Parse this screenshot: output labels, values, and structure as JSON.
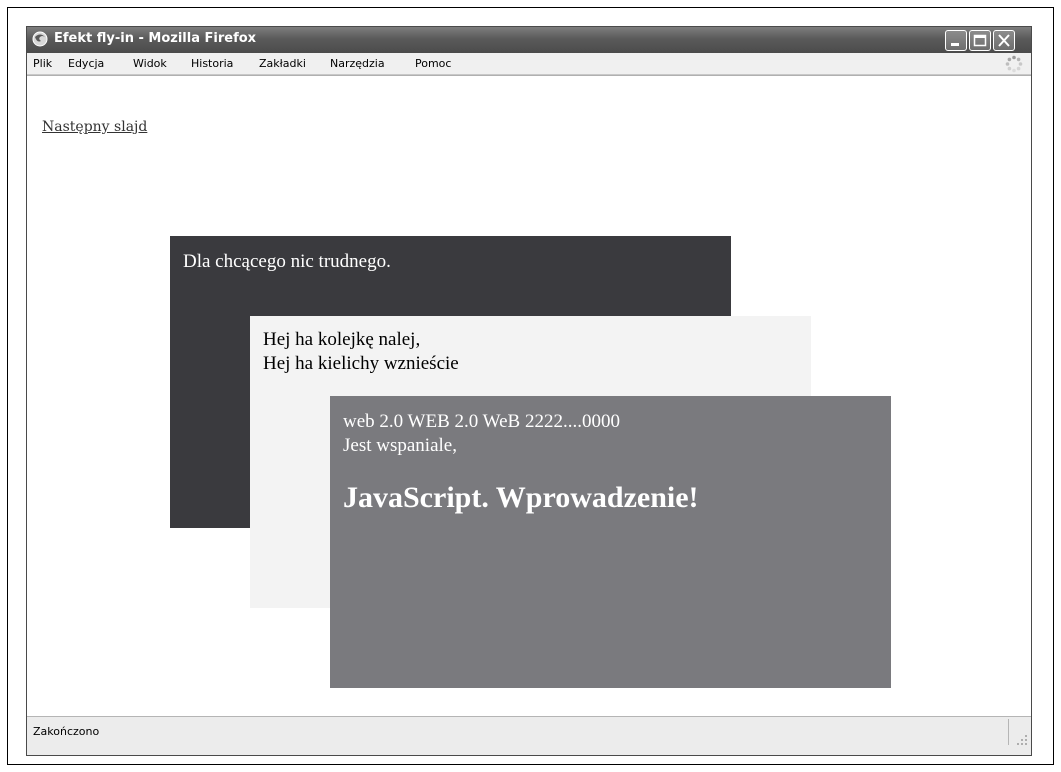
{
  "window": {
    "title": "Efekt fly-in - Mozilla Firefox"
  },
  "menu": {
    "items": [
      {
        "label": "Plik"
      },
      {
        "label": "Edycja"
      },
      {
        "label": "Widok"
      },
      {
        "label": "Historia"
      },
      {
        "label": "Zakładki"
      },
      {
        "label": "Narzędzia"
      },
      {
        "label": "Pomoc"
      }
    ]
  },
  "content": {
    "next_link": "Następny slajd",
    "slides": [
      {
        "lines": [
          "Dla chcącego nic trudnego."
        ],
        "color": "#3a3a3e"
      },
      {
        "lines": [
          "Hej ha kolejkę nalej,",
          "Hej ha kielichy wznieście"
        ],
        "color": "#f3f3f3"
      },
      {
        "lines": [
          "web 2.0 WEB 2.0 WeB 2222....0000",
          "Jest wspaniale,"
        ],
        "big": "JavaScript. Wprowadzenie!",
        "color": "#7a7a7e"
      }
    ]
  },
  "statusbar": {
    "text": "Zakończono"
  },
  "icons": {
    "title": "firefox-icon",
    "minimize": "minimize-icon",
    "maximize": "maximize-icon",
    "close": "close-icon",
    "throbber": "throbber-icon",
    "grip": "resize-grip-icon"
  }
}
